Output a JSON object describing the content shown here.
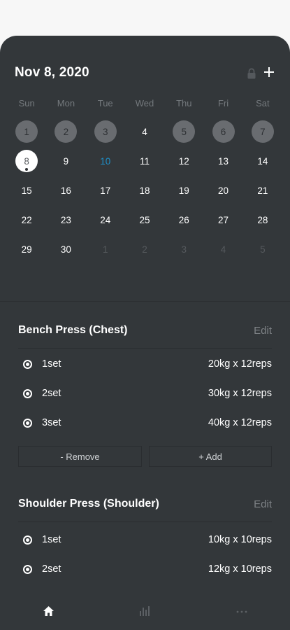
{
  "calendar": {
    "title": "Nov 8, 2020",
    "weekdays": [
      "Sun",
      "Mon",
      "Tue",
      "Wed",
      "Thu",
      "Fri",
      "Sat"
    ],
    "weeks": [
      [
        {
          "d": "1",
          "s": "done"
        },
        {
          "d": "2",
          "s": "done"
        },
        {
          "d": "3",
          "s": "done"
        },
        {
          "d": "4",
          "s": ""
        },
        {
          "d": "5",
          "s": "done"
        },
        {
          "d": "6",
          "s": "done"
        },
        {
          "d": "7",
          "s": "done"
        }
      ],
      [
        {
          "d": "8",
          "s": "today"
        },
        {
          "d": "9",
          "s": ""
        },
        {
          "d": "10",
          "s": "accent"
        },
        {
          "d": "11",
          "s": ""
        },
        {
          "d": "12",
          "s": ""
        },
        {
          "d": "13",
          "s": ""
        },
        {
          "d": "14",
          "s": ""
        }
      ],
      [
        {
          "d": "15",
          "s": ""
        },
        {
          "d": "16",
          "s": ""
        },
        {
          "d": "17",
          "s": ""
        },
        {
          "d": "18",
          "s": ""
        },
        {
          "d": "19",
          "s": ""
        },
        {
          "d": "20",
          "s": ""
        },
        {
          "d": "21",
          "s": ""
        }
      ],
      [
        {
          "d": "22",
          "s": ""
        },
        {
          "d": "23",
          "s": ""
        },
        {
          "d": "24",
          "s": ""
        },
        {
          "d": "25",
          "s": ""
        },
        {
          "d": "26",
          "s": ""
        },
        {
          "d": "27",
          "s": ""
        },
        {
          "d": "28",
          "s": ""
        }
      ],
      [
        {
          "d": "29",
          "s": ""
        },
        {
          "d": "30",
          "s": ""
        },
        {
          "d": "1",
          "s": "muted"
        },
        {
          "d": "2",
          "s": "muted"
        },
        {
          "d": "3",
          "s": "muted"
        },
        {
          "d": "4",
          "s": "muted"
        },
        {
          "d": "5",
          "s": "muted"
        }
      ]
    ]
  },
  "exercises": [
    {
      "title": "Bench Press (Chest)",
      "edit_label": "Edit",
      "sets": [
        {
          "label": "1set",
          "value": "20kg x 12reps"
        },
        {
          "label": "2set",
          "value": "30kg x 12reps"
        },
        {
          "label": "3set",
          "value": "40kg x 12reps"
        }
      ],
      "remove_label": "- Remove",
      "add_label": "+ Add"
    },
    {
      "title": "Shoulder Press (Shoulder)",
      "edit_label": "Edit",
      "sets": [
        {
          "label": "1set",
          "value": "10kg x 10reps"
        },
        {
          "label": "2set",
          "value": "12kg x 10reps"
        }
      ]
    }
  ],
  "tabbar": {
    "icons": [
      "home-icon",
      "chart-icon",
      "more-icon"
    ],
    "active_color": "#ffffff",
    "inactive_color": "#5c6064"
  },
  "colors": {
    "background": "#33373a",
    "completed_day": "#696c70",
    "accent_day": "#1e8fc8"
  }
}
